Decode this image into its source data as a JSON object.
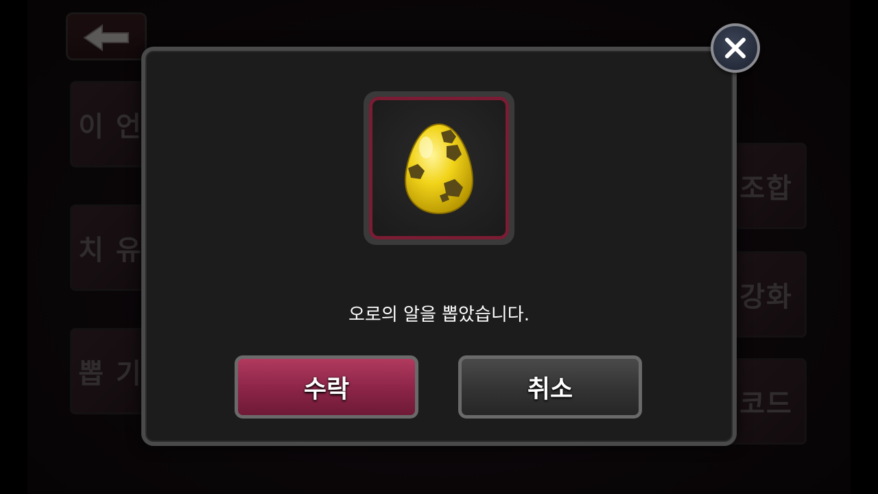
{
  "background_menu": {
    "left_buttons": [
      "이 언",
      "치 유",
      "뽑 기"
    ],
    "right_buttons": [
      "조합",
      "강화",
      "코드"
    ]
  },
  "dialog": {
    "item_name": "오로의 알",
    "message": "오로의 알을 뽑았습니다.",
    "accept_label": "수락",
    "cancel_label": "취소"
  },
  "icons": {
    "back": "back-arrow-icon",
    "close": "close-icon",
    "item": "yellow-egg-icon"
  },
  "colors": {
    "accept": "#8b2447",
    "cancel": "#333333",
    "frame_accent": "#7a1c34",
    "egg": "#f2d41a"
  }
}
